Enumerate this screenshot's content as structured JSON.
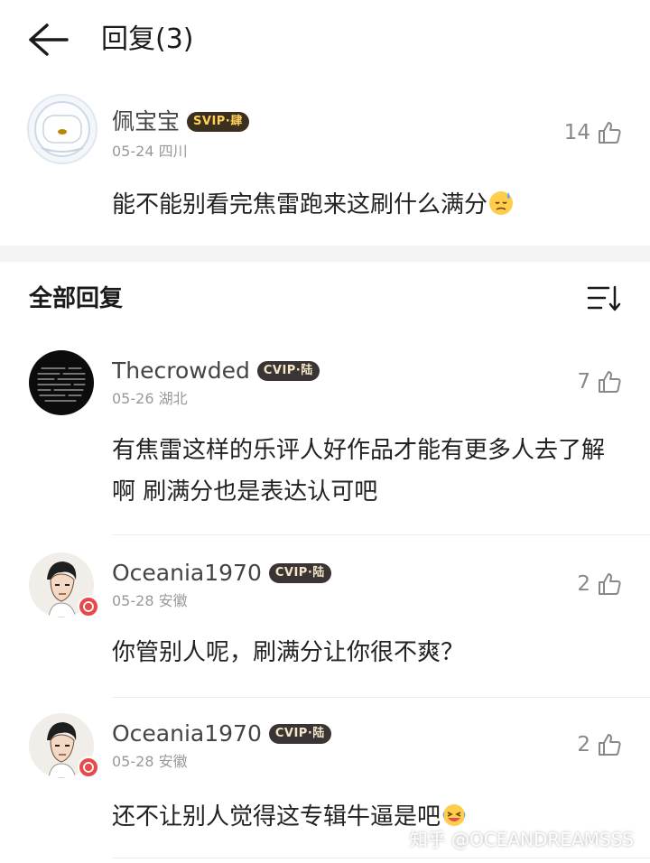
{
  "header": {
    "title": "回复(3)"
  },
  "root_comment": {
    "username": "佩宝宝",
    "badge": "SVIP·肆",
    "date": "05-24",
    "location": "四川",
    "likes": "14",
    "text": "能不能别看完焦雷跑来这刷什么满分"
  },
  "section": {
    "title": "全部回复"
  },
  "replies": [
    {
      "username": "Thecrowded",
      "badge": "CVIP·陆",
      "date": "05-26",
      "location": "湖北",
      "likes": "7",
      "text": "有焦雷这样的乐评人好作品才能有更多人去了解啊 刷满分也是表达认可吧"
    },
    {
      "username": "Oceania1970",
      "badge": "CVIP·陆",
      "date": "05-28",
      "location": "安徽",
      "likes": "2",
      "text": "你管别人呢，刷满分让你很不爽？"
    },
    {
      "username": "Oceania1970",
      "badge": "CVIP·陆",
      "date": "05-28",
      "location": "安徽",
      "likes": "2",
      "text": "还不让别人觉得这专辑牛逼是吧"
    }
  ],
  "watermark": "知乎 @OCEANDREAMSSS"
}
